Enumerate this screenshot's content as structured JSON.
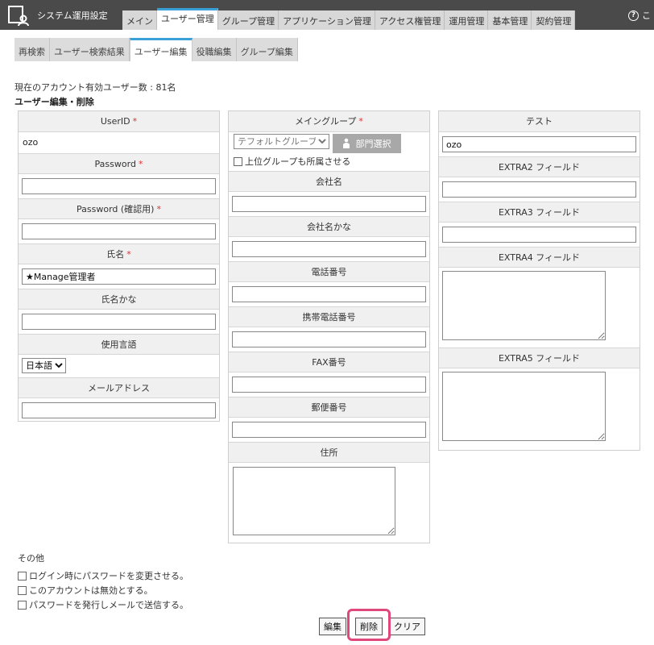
{
  "app": {
    "title": "システム運用設定",
    "help_label": "こ"
  },
  "main_tabs": [
    "メイン",
    "ユーザー管理",
    "グループ管理",
    "アプリケーション管理",
    "アクセス権管理",
    "運用管理",
    "基本管理",
    "契約管理"
  ],
  "sub_tabs": [
    "再検索",
    "ユーザー検索結果",
    "ユーザー編集",
    "役職編集",
    "グループ編集"
  ],
  "account_info": "現在のアカウント有効ユーザー数 : 81名",
  "section_title": "ユーザー編集・削除",
  "required_mark": "*",
  "left": {
    "userid_label": "UserID",
    "userid_value": "ozo",
    "password_label": "Password",
    "password_confirm_label": "Password (確認用)",
    "name_label": "氏名",
    "name_value": "★Manage管理者",
    "name_kana_label": "氏名かな",
    "language_label": "使用言語",
    "language_value": "日本語",
    "email_label": "メールアドレス"
  },
  "middle": {
    "main_group_label": "メイングループ",
    "main_group_value": "テフォルトグループ",
    "dept_select_label": "部門選択",
    "upper_group_label": "上位グループも所属させる",
    "company_label": "会社名",
    "company_kana_label": "会社名かな",
    "phone_label": "電話番号",
    "mobile_label": "携帯電話番号",
    "fax_label": "FAX番号",
    "postal_label": "郵便番号",
    "address_label": "住所"
  },
  "right": {
    "test_label": "テスト",
    "test_value": "ozo",
    "extra2_label": "EXTRA2 フィールド",
    "extra3_label": "EXTRA3 フィールド",
    "extra4_label": "EXTRA4 フィールド",
    "extra5_label": "EXTRA5 フィールド"
  },
  "other": {
    "title": "その他",
    "options": [
      "ログイン時にパスワードを変更させる。",
      "このアカウントは無効とする。",
      "パスワードを発行しメールで送信する。"
    ]
  },
  "buttons": {
    "edit": "編集",
    "delete": "削除",
    "clear": "クリア"
  },
  "colors": {
    "topbar": "#4a4a4a",
    "accent": "#3aa0d8",
    "required": "#e03030",
    "highlight": "#e0487c"
  }
}
